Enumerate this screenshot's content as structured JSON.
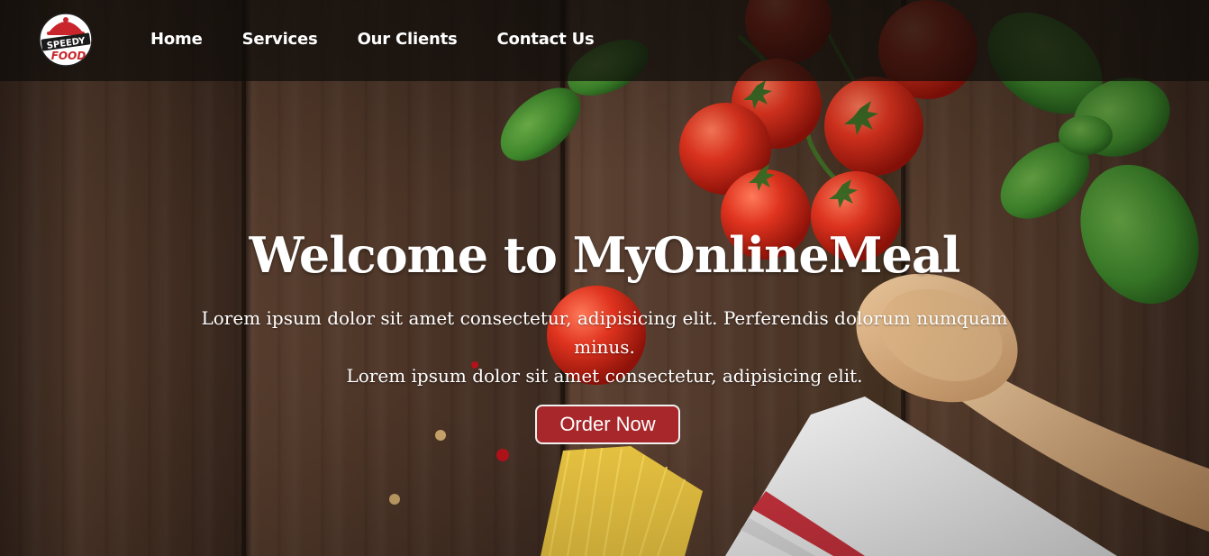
{
  "logo": {
    "line1": "SPEEDY",
    "line2": "FOOD"
  },
  "nav": {
    "links": [
      "Home",
      "Services",
      "Our Clients",
      "Contact Us"
    ]
  },
  "hero": {
    "title": "Welcome to MyOnlineMeal",
    "paragraph1": "Lorem ipsum dolor sit amet consectetur, adipisicing elit. Perferendis dolorum numquam minus.",
    "paragraph2": "Lorem ipsum dolor sit amet consectetur, adipisicing elit.",
    "button": "Order Now"
  },
  "colors": {
    "nav_bg": "#0f0c0a",
    "button_bg": "#a8272a",
    "logo_red": "#c8262c",
    "wood": "#4a3326"
  }
}
